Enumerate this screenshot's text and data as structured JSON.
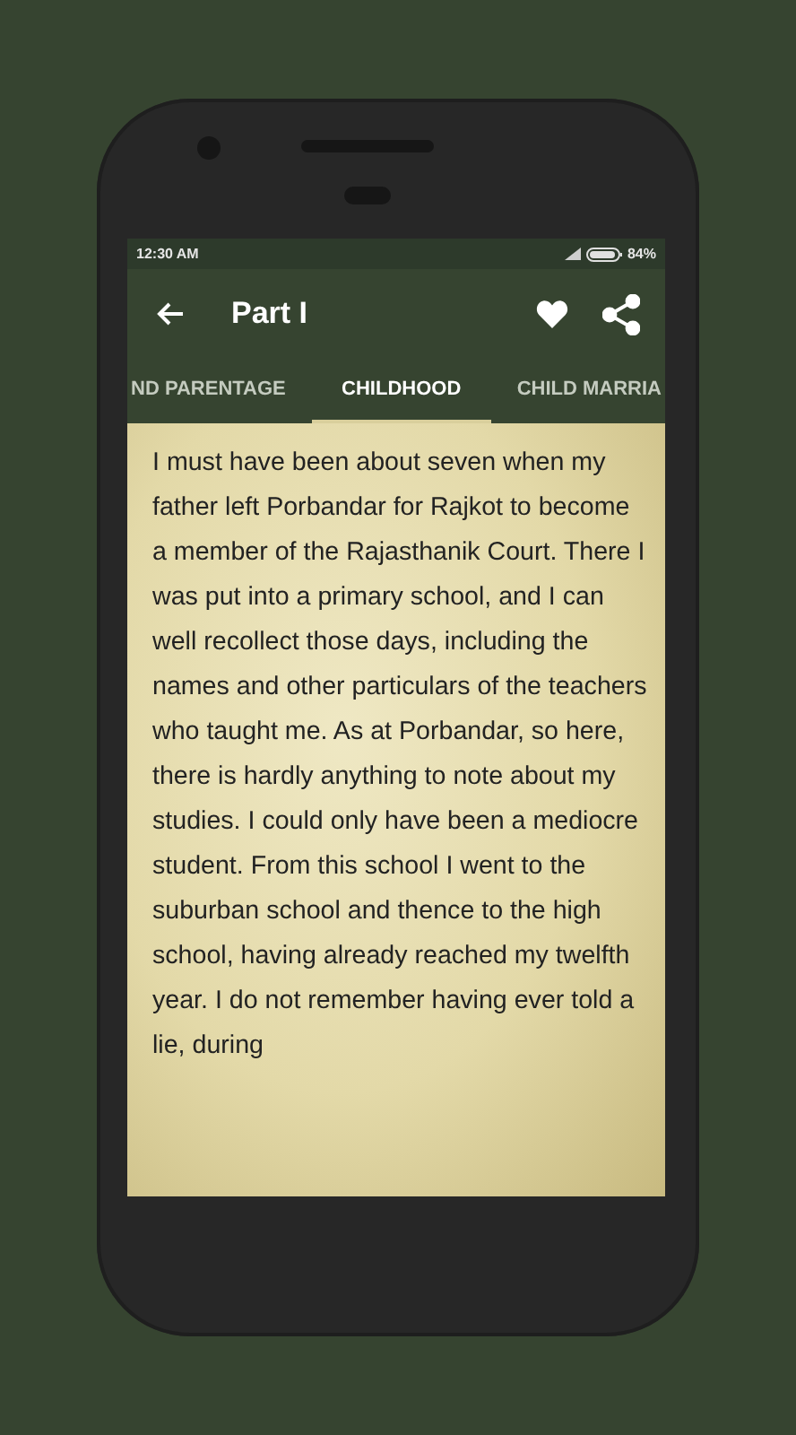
{
  "status_bar": {
    "time": "12:30 AM",
    "battery": "84%"
  },
  "toolbar": {
    "title": "Part I"
  },
  "tabs": [
    {
      "label": "ND PARENTAGE",
      "selected": false
    },
    {
      "label": "CHILDHOOD",
      "selected": true
    },
    {
      "label": "CHILD MARRIA",
      "selected": false
    }
  ],
  "content": {
    "text": "I must have been about seven when my father left Porbandar for Rajkot to become a member of the Rajasthanik Court. There I was put into a primary school, and I can well recollect those days, including the names and other particulars of the teachers who taught me. As at Porbandar, so here, there is hardly anything to note about my studies. I could only have been a mediocre student. From this school I went to the suburban school and thence to the high school, having already reached my twelfth year. I do not remember having ever told a lie, during"
  }
}
